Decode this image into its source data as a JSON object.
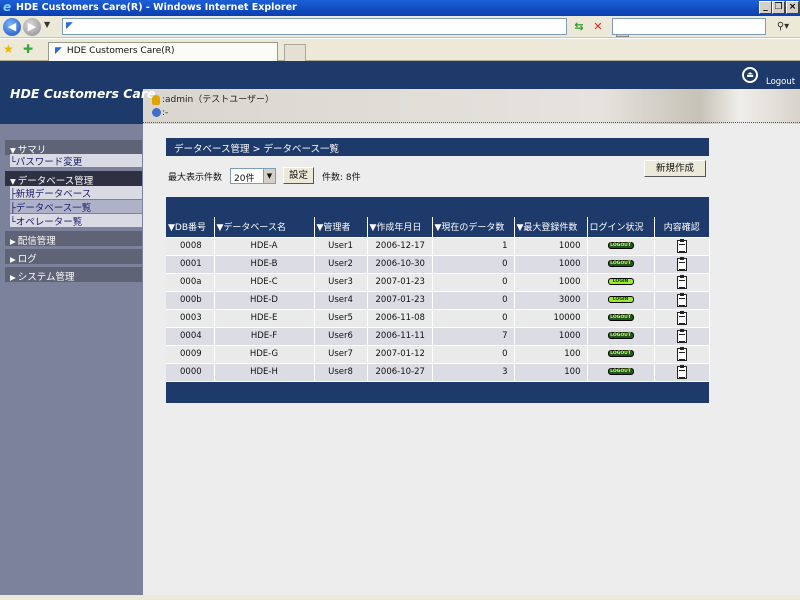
{
  "window": {
    "title": "HDE Customers Care(R) - Windows Internet Explorer"
  },
  "tab": {
    "label": "HDE Customers Care(R)"
  },
  "header": {
    "brand": "HDE Customers Care",
    "logout_label": "Logout",
    "user": ":admin（テストユーザー）",
    "db": ":-"
  },
  "sidebar": {
    "groups": [
      {
        "label": "サマリ",
        "items": [
          "パスワード変更"
        ]
      },
      {
        "label": "データベース管理",
        "items": [
          "新規データベース",
          "データベース一覧",
          "オペレーター覧"
        ]
      },
      {
        "label": "配信管理"
      },
      {
        "label": "ログ"
      },
      {
        "label": "システム管理"
      }
    ]
  },
  "main": {
    "breadcrumb": "データベース管理 > データベース一覧",
    "new_button": "新規作成",
    "max_rows_label": "最大表示件数",
    "max_rows_value": "20件",
    "set_button": "設定",
    "count_text": "件数: 8件"
  },
  "table": {
    "headers": [
      "▼DB番号",
      "▼データベース名",
      "▼管理者",
      "▼作成年月日",
      "▼現在のデータ数",
      "▼最大登録件数",
      "ログイン状況",
      "内容確認"
    ],
    "rows": [
      {
        "id": "0008",
        "name": "HDE-A",
        "admin": "User1",
        "created": "2006-12-17",
        "current": "1",
        "max": "1000",
        "status": "LOGOUT"
      },
      {
        "id": "0001",
        "name": "HDE-B",
        "admin": "User2",
        "created": "2006-10-30",
        "current": "0",
        "max": "1000",
        "status": "LOGOUT"
      },
      {
        "id": "000a",
        "name": "HDE-C",
        "admin": "User3",
        "created": "2007-01-23",
        "current": "0",
        "max": "1000",
        "status": "LOGIN"
      },
      {
        "id": "000b",
        "name": "HDE-D",
        "admin": "User4",
        "created": "2007-01-23",
        "current": "0",
        "max": "3000",
        "status": "LOGIN"
      },
      {
        "id": "0003",
        "name": "HDE-E",
        "admin": "User5",
        "created": "2006-11-08",
        "current": "0",
        "max": "10000",
        "status": "LOGOUT"
      },
      {
        "id": "0004",
        "name": "HDE-F",
        "admin": "User6",
        "created": "2006-11-11",
        "current": "7",
        "max": "1000",
        "status": "LOGOUT"
      },
      {
        "id": "0009",
        "name": "HDE-G",
        "admin": "User7",
        "created": "2007-01-12",
        "current": "0",
        "max": "100",
        "status": "LOGOUT"
      },
      {
        "id": "0000",
        "name": "HDE-H",
        "admin": "User8",
        "created": "2006-10-27",
        "current": "3",
        "max": "100",
        "status": "LOGOUT"
      }
    ]
  }
}
